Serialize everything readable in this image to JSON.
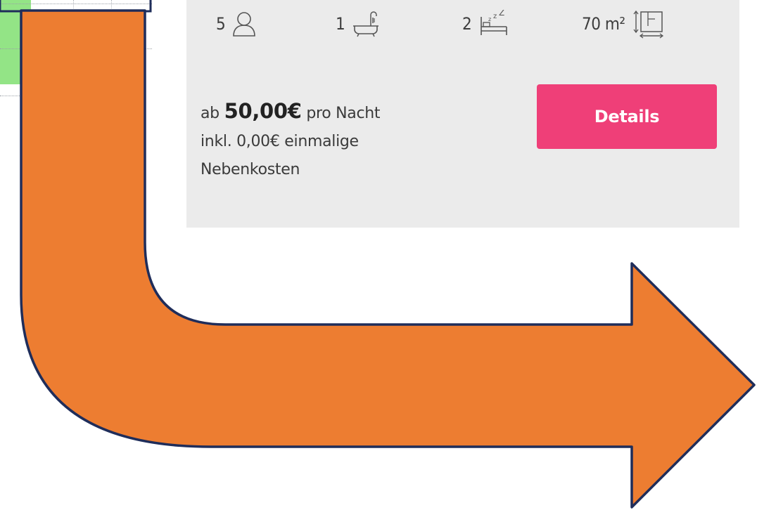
{
  "listing": {
    "features": [
      {
        "value": "5",
        "icon": "person-icon"
      },
      {
        "value": "1",
        "icon": "bathtub-icon"
      },
      {
        "value": "2",
        "icon": "bed-icon"
      },
      {
        "value": "70 m²",
        "icon": "floorplan-icon"
      }
    ],
    "price": {
      "prefix": "ab",
      "amount": "50,00€",
      "suffix": "pro Nacht",
      "line2": "inkl. 0,00€ einmalige",
      "line3": "Nebenkosten"
    },
    "details_button": "Details"
  },
  "colors": {
    "card_background": "#ebebeb",
    "button": "#ef3f78",
    "calendar_booked": "#93e486",
    "arrow_fill": "#ed7d31",
    "arrow_stroke": "#1f2d5a"
  }
}
